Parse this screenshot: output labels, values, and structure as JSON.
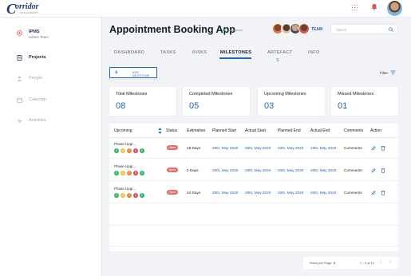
{
  "brand": {
    "logo_letter": "C",
    "logo_word": "orridor",
    "logo_sub": "MANAGEMENT"
  },
  "sidebar": {
    "items": [
      {
        "label": "IPMS",
        "sub": "Admin Team"
      },
      {
        "label": "Projects"
      },
      {
        "label": "People"
      },
      {
        "label": "Calendar"
      },
      {
        "label": "Activities"
      }
    ]
  },
  "header": {
    "title": "Appointment Booking App",
    "status": "In progress",
    "team_label": "TEAM",
    "search_placeholder": "Search"
  },
  "tabs": [
    {
      "label": "DASHBOARD"
    },
    {
      "label": "TASKS"
    },
    {
      "label": "RISKS"
    },
    {
      "label": "MILESTONES"
    },
    {
      "label": "ARTEFACT"
    },
    {
      "label": "S"
    },
    {
      "label": "INFO"
    }
  ],
  "add_button": {
    "plus": "+",
    "label": "ADD MILESTONE"
  },
  "filter": {
    "label": "Filter"
  },
  "cards": [
    {
      "title": "Total Milestones",
      "value": "08"
    },
    {
      "title": "Completed Milestones",
      "value": "05"
    },
    {
      "title": "Upcoming Milestones",
      "value": "03"
    },
    {
      "title": "Missed Milestones",
      "value": "01"
    }
  ],
  "table": {
    "columns": [
      "Upcoming",
      "Status",
      "Estimation",
      "Planned Start",
      "Actual Start",
      "Planned End",
      "Actual End",
      "Comments",
      "Action"
    ],
    "rows": [
      {
        "phase": "Phase Upgr...",
        "status": "Open",
        "estimation": "18 Days",
        "planned_start": "20th, May 2020",
        "actual_start": "05th, May 2020",
        "planned_end": "20th, May 2020",
        "actual_end": "23th, May 2020",
        "comments": "Comments",
        "dots": [
          "S",
          "G",
          "T",
          "D",
          "E"
        ]
      },
      {
        "phase": "Phase Upgr...",
        "status": "Open",
        "estimation": "2 Days",
        "planned_start": "20th, May 2020",
        "actual_start": "20th, May 2020",
        "planned_end": "20th, May 2020",
        "actual_end": "20th, May 2020",
        "comments": "Comments",
        "dots": [
          "S",
          "G",
          "T",
          "D",
          "E"
        ]
      },
      {
        "phase": "Phase Upgr...",
        "status": "Open",
        "estimation": "24 Days",
        "planned_start": "20th, May 2020",
        "actual_start": "20th, May 2020",
        "planned_end": "20th, May 2020",
        "actual_end": "20th, May 2020",
        "comments": "Comments",
        "dots": [
          "S",
          "G",
          "T",
          "D",
          "E"
        ]
      }
    ]
  },
  "pager": {
    "rows_per_page_label": "Rows per Page:",
    "rows_per_page_value": "5",
    "range": "1 - 5 of 12",
    "prev": "‹",
    "next": "›"
  },
  "colors": {
    "accent": "#1f65b8",
    "status_open": "#e2706a",
    "dot_colors": [
      "#2db36b",
      "#e8c53a",
      "#e9843a",
      "#d94848",
      "#2db36b"
    ]
  }
}
